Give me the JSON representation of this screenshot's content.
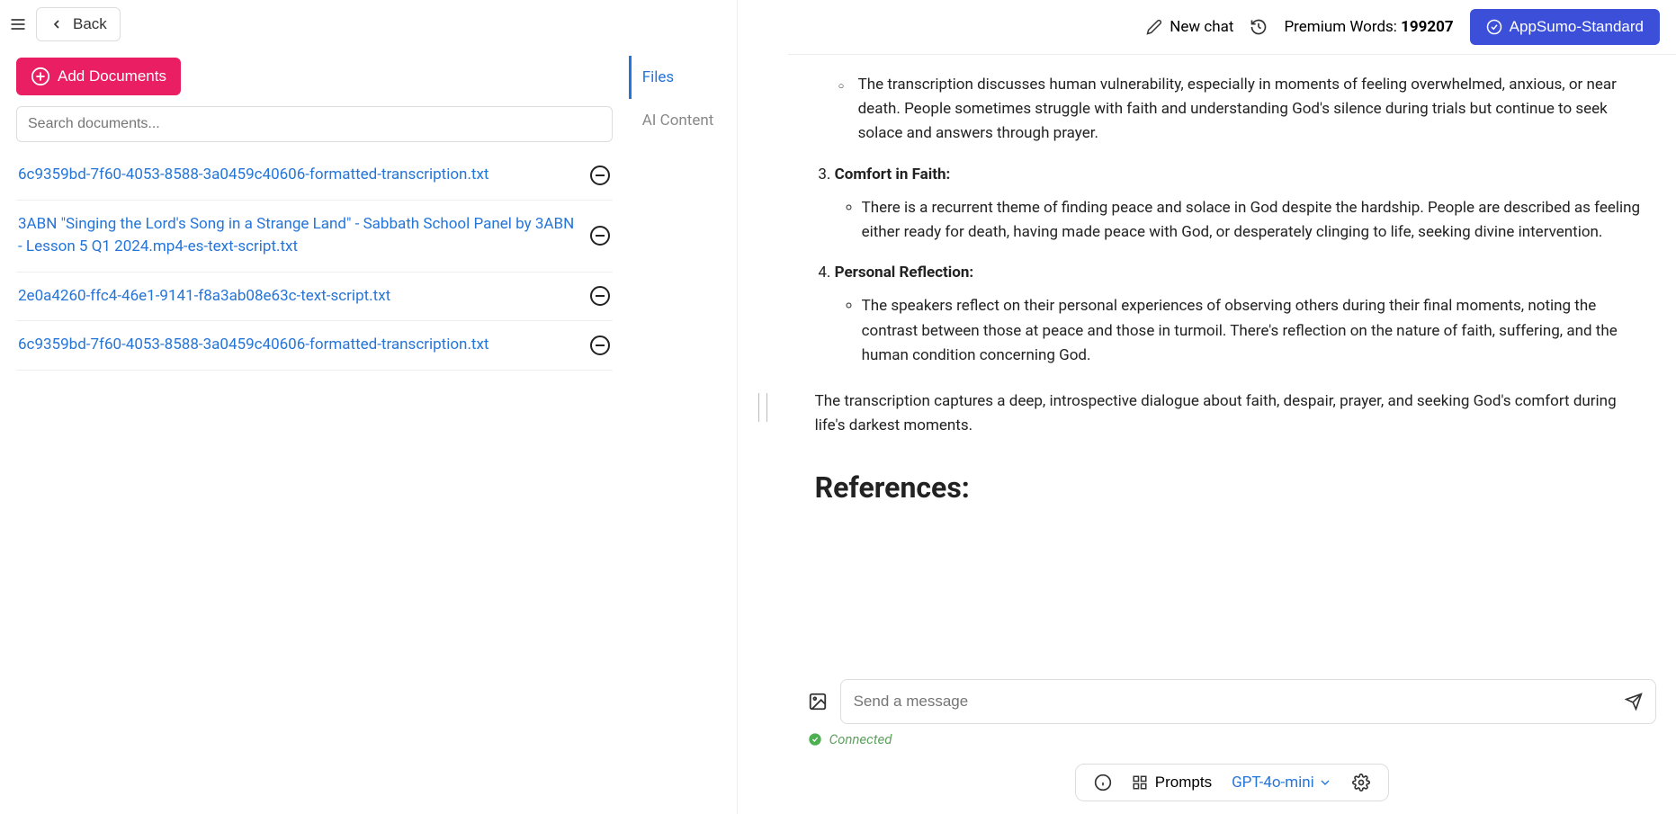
{
  "back_label": "Back",
  "add_documents_label": "Add Documents",
  "search_placeholder": "Search documents...",
  "documents": [
    {
      "name": "6c9359bd-7f60-4053-8588-3a0459c40606-formatted-transcription.txt"
    },
    {
      "name": "3ABN \"Singing the Lord's Song in a Strange Land\" - Sabbath School Panel by 3ABN - Lesson 5 Q1 2024.mp4-es-text-script.txt"
    },
    {
      "name": "2e0a4260-ffc4-46e1-9141-f8a3ab08e63c-text-script.txt"
    },
    {
      "name": "6c9359bd-7f60-4053-8588-3a0459c40606-formatted-transcription.txt"
    }
  ],
  "side_tabs": {
    "files": "Files",
    "ai_content": "AI Content"
  },
  "header": {
    "new_chat": "New chat",
    "premium_words_label": "Premium Words:",
    "premium_words_value": "199207",
    "plan_button": "AppSumo-Standard"
  },
  "chat": {
    "partial_first_bullet": "The transcription discusses human vulnerability, especially in moments of feeling overwhelmed, anxious, or near death. People sometimes struggle with faith and understanding God's silence during trials but continue to seek solace and answers through prayer.",
    "item3_title": "Comfort in Faith:",
    "item3_text": "There is a recurrent theme of finding peace and solace in God despite the hardship. People are described as feeling either ready for death, having made peace with God, or desperately clinging to life, seeking divine intervention.",
    "item4_title": "Personal Reflection:",
    "item4_text": "The speakers reflect on their personal experiences of observing others during their final moments, noting the contrast between those at peace and those in turmoil. There's reflection on the nature of faith, suffering, and the human condition concerning God.",
    "closing": "The transcription captures a deep, introspective dialogue about faith, despair, prayer, and seeking God's comfort during life's darkest moments.",
    "references": "References:"
  },
  "input_placeholder": "Send a message",
  "connected_label": "Connected",
  "bottom_bar": {
    "prompts": "Prompts",
    "model": "GPT-4o-mini"
  }
}
